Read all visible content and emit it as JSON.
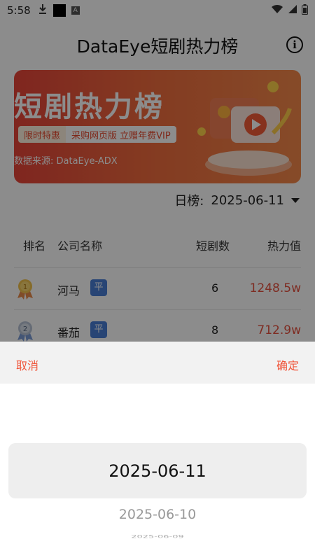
{
  "status_bar": {
    "time": "5:58",
    "a_glyph": "A"
  },
  "header": {
    "title": "DataEye短剧热力榜"
  },
  "banner": {
    "big_title": "短剧热力榜",
    "promo_left": "限时特惠",
    "promo_right": "采购网页版 立赠年费VIP",
    "source": "数据来源: DataEye-ADX"
  },
  "date_selector": {
    "label": "日榜:",
    "value": "2025-06-11"
  },
  "table": {
    "headers": {
      "rank": "排名",
      "company": "公司名称",
      "dramas": "短剧数",
      "heat": "热力值"
    },
    "rows": [
      {
        "rank_medal": "1",
        "company": "河马",
        "badge": "平",
        "count": "6",
        "heat": "1248.5w"
      },
      {
        "rank_medal": "2",
        "company": "番茄",
        "badge": "平",
        "count": "8",
        "heat": "712.9w"
      }
    ]
  },
  "picker": {
    "cancel": "取消",
    "confirm": "确定",
    "selected": "2025-06-11",
    "next": "2025-06-10",
    "next2": "2025-06-09"
  },
  "colors": {
    "accent": "#f0553a",
    "badge": "#4a7fd6",
    "heat": "#e5503e"
  }
}
